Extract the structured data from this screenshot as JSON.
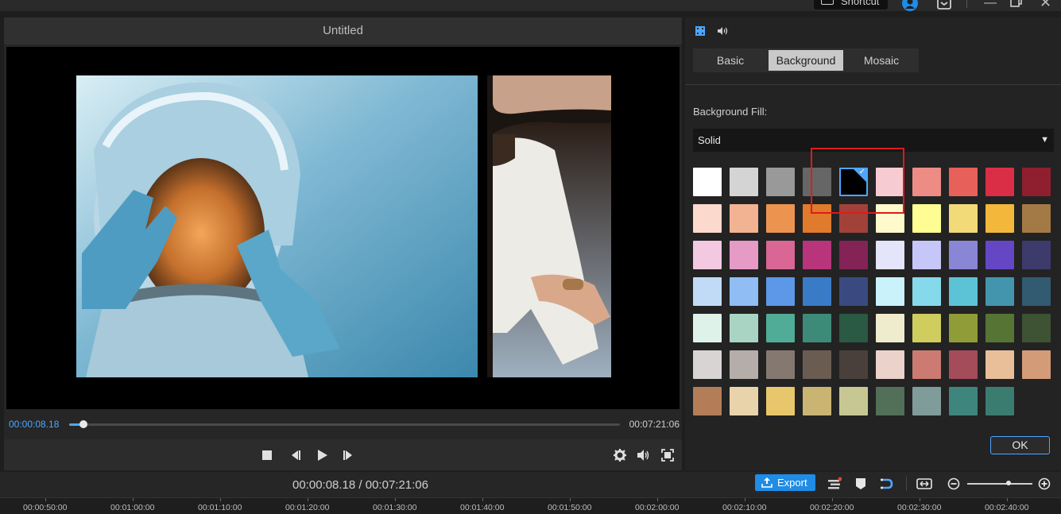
{
  "topbar": {
    "shortcut_label": "Shortcut",
    "icons": [
      "keyboard-icon",
      "account-icon",
      "download-icon",
      "minimize-icon",
      "restore-icon",
      "close-icon"
    ]
  },
  "preview": {
    "title": "Untitled",
    "current_time": "00:00:08.18",
    "total_time": "00:07:21:06",
    "progress": 0.026
  },
  "controls": {
    "icons": [
      "stop-icon",
      "prev-frame-icon",
      "play-icon",
      "next-frame-icon",
      "settings-icon",
      "volume-icon",
      "fullscreen-icon"
    ]
  },
  "properties": {
    "icons": [
      "video-icon",
      "audio-icon"
    ],
    "tabs": [
      {
        "label": "Basic",
        "active": false
      },
      {
        "label": "Background",
        "active": true
      },
      {
        "label": "Mosaic",
        "active": false
      }
    ],
    "background_fill_label": "Background Fill:",
    "fill_mode": "Solid",
    "selected_swatch": 4,
    "swatch_rows": [
      [
        "#ffffff",
        "#d4d4d4",
        "#999999",
        "#666666",
        "#000000",
        "#f6ccd2",
        "#ec8c85",
        "#e8605a",
        "#d92e45",
        "#8f1f2f"
      ],
      [
        "#fbd9cc",
        "#f2b393",
        "#ed9350",
        "#e07a2d",
        "#a2413a",
        "#fffacb",
        "#fdfd93",
        "#f3da79",
        "#f2b73b",
        "#a37a45"
      ],
      [
        "#f2c9e0",
        "#e69ac6",
        "#d96694",
        "#b8347b",
        "#842356",
        "#e4e4fa",
        "#c6c6f9",
        "#8a86d6",
        "#6547c6",
        "#3d3a6c"
      ],
      [
        "#c1dbf7",
        "#8fbdf4",
        "#5c98e7",
        "#3a7bc8",
        "#3a4a80",
        "#c9f2fb",
        "#85d9eb",
        "#5cc3d6",
        "#4395ad",
        "#325a70"
      ],
      [
        "#dff2ea",
        "#a9d4c4",
        "#50ab97",
        "#3d8a78",
        "#2a5944",
        "#efebcd",
        "#cfcd5e",
        "#8f9c37",
        "#567535",
        "#3e5234"
      ],
      [
        "#d8d4d4",
        "#b5ada9",
        "#857870",
        "#6b5c52",
        "#4a403b",
        "#ebd2cb",
        "#cb7b72",
        "#a44c59",
        "#e8bf99",
        "#d49b79"
      ],
      [
        "#b37d58",
        "#e9d3aa",
        "#e8c66b",
        "#c9b474",
        "#c7c793",
        "#526f57",
        "#7f9b9a",
        "#3e857e",
        "#3a7c70"
      ]
    ],
    "ok_label": "OK"
  },
  "toolbar": {
    "time": "00:00:08.18 / 00:07:21:06",
    "export_label": "Export",
    "icons": [
      "tracks-icon",
      "marker-icon",
      "magnet-icon",
      "fit-icon",
      "zoom-out-icon",
      "zoom-in-icon"
    ],
    "zoom_level": 0.62
  },
  "ruler": {
    "ticks": [
      "00:00:50:00",
      "00:01:00:00",
      "00:01:10:00",
      "00:01:20:00",
      "00:01:30:00",
      "00:01:40:00",
      "00:01:50:00",
      "00:02:00:00",
      "00:02:10:00",
      "00:02:20:00",
      "00:02:30:00",
      "00:02:40:00"
    ]
  }
}
